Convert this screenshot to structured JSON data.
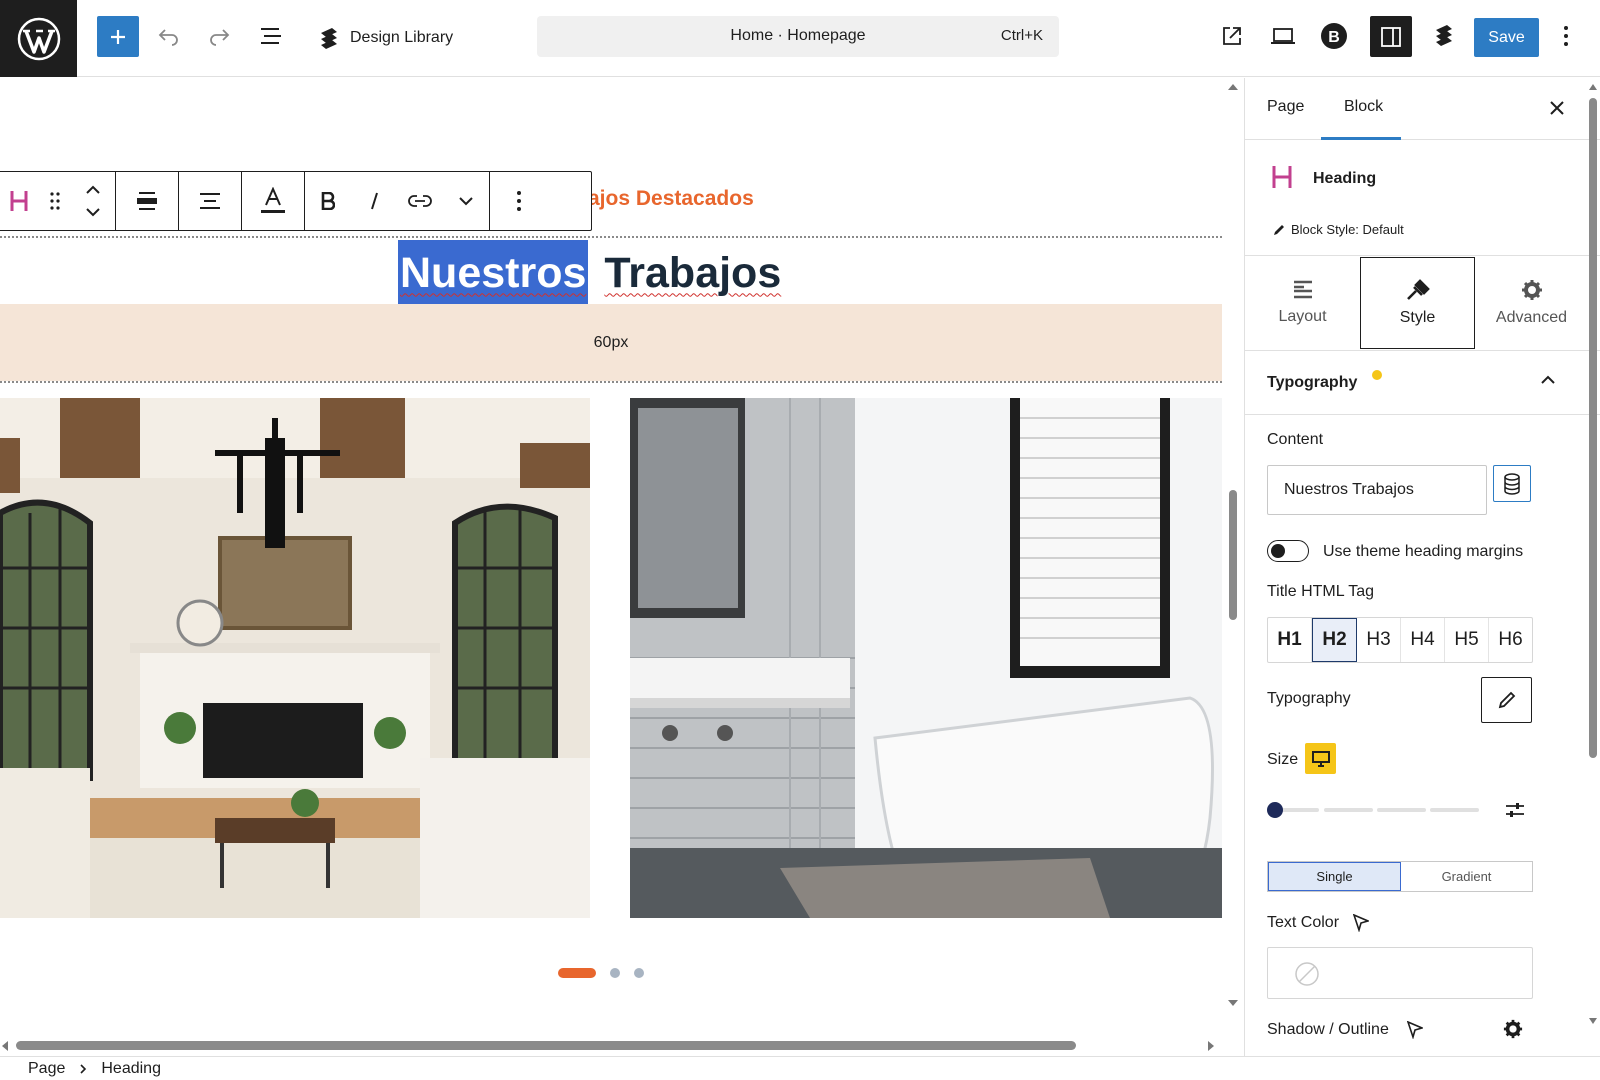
{
  "topbar": {
    "design_library_label": "Design Library",
    "command_title": "Home · Homepage",
    "command_shortcut": "Ctrl+K",
    "save_label": "Save"
  },
  "canvas": {
    "subtitle": "ajos Destacados",
    "heading_selected": "Nuestros",
    "heading_rest": "Trabajos",
    "spacer_label": "60px",
    "carousel_pages": 3,
    "carousel_active": 1,
    "accent_color": "#e8662d"
  },
  "sidebar": {
    "tabs": [
      "Page",
      "Block"
    ],
    "active_tab": "Block",
    "block_name": "Heading",
    "block_style": "Block Style: Default",
    "inspector_tabs": [
      "Layout",
      "Style",
      "Advanced"
    ],
    "active_inspector_tab": "Style",
    "typography_section": "Typography",
    "content_label": "Content",
    "content_value": "Nuestros Trabajos",
    "theme_margins_label": "Use theme heading margins",
    "theme_margins_on": false,
    "html_tag_label": "Title HTML Tag",
    "html_tags": [
      "H1",
      "H2",
      "H3",
      "H4",
      "H5",
      "H6"
    ],
    "active_html_tag": "H2",
    "typography_label": "Typography",
    "size_label": "Size",
    "color_modes": [
      "Single",
      "Gradient"
    ],
    "active_color_mode": "Single",
    "text_color_label": "Text Color",
    "shadow_label": "Shadow / Outline"
  },
  "breadcrumb": {
    "items": [
      "Page",
      "Heading"
    ]
  }
}
